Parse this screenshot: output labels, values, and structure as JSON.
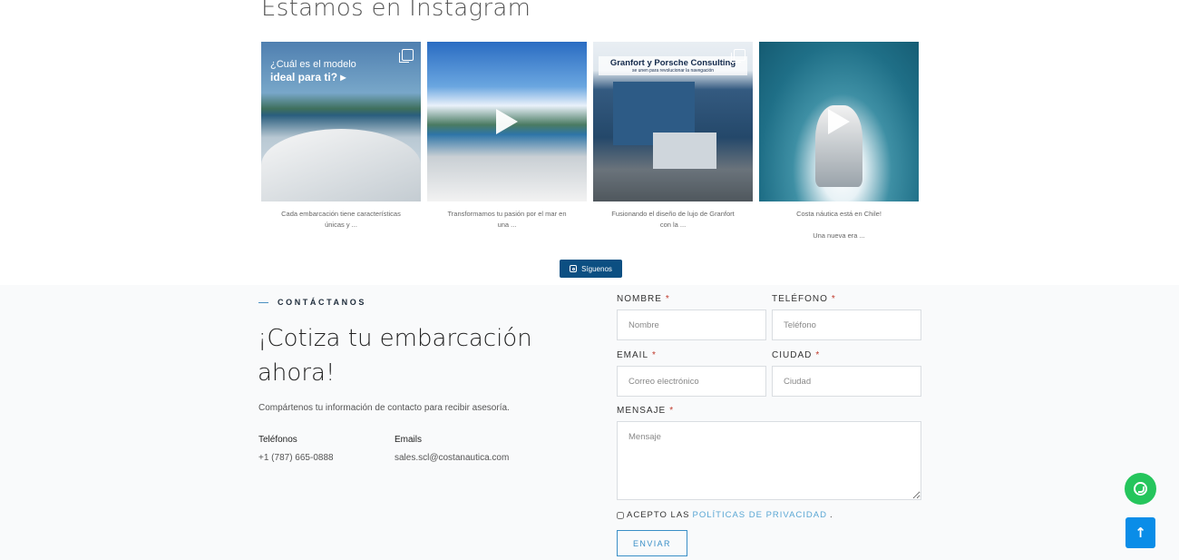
{
  "instagram": {
    "title": "Estamos en Instagram",
    "posts": [
      {
        "overlay_line1": "¿Cuál es el modelo",
        "overlay_line2": "ideal para ti? ▸",
        "caption_1": "Cada embarcación tiene características",
        "caption_2": "únicas y ...",
        "caption_3": ""
      },
      {
        "caption_1": "Transformamos tu pasión por el mar en",
        "caption_2": "una ...",
        "caption_3": ""
      },
      {
        "overlay_head": "Granfort y Porsche Consulting",
        "overlay_sub": "se unen para revolucionar la navegación",
        "caption_1": "Fusionando el diseño de lujo de Granfort",
        "caption_2": "con la ...",
        "caption_3": ""
      },
      {
        "caption_1": "Costa náutica está en Chile!",
        "caption_2": "",
        "caption_3": "Una nueva era ..."
      }
    ],
    "follow_label": "Síguenos"
  },
  "contact": {
    "eyebrow": "CONTÁCTANOS",
    "title": "¡Cotiza tu embarcación ahora!",
    "subtitle": "Compártenos tu información de contacto para recibir asesoría.",
    "phones_label": "Teléfonos",
    "phones_value": "+1 (787) 665-0888",
    "emails_label": "Emails",
    "emails_value": "sales.scl@costanautica.com"
  },
  "form": {
    "name_label": "NOMBRE",
    "name_placeholder": "Nombre",
    "phone_label": "TELÉFONO",
    "phone_placeholder": "Teléfono",
    "email_label": "EMAIL",
    "email_placeholder": "Correo electrónico",
    "city_label": "CIUDAD",
    "city_placeholder": "Ciudad",
    "message_label": "MENSAJE",
    "message_placeholder": "Mensaje",
    "required_mark": "*",
    "accept_prefix": "ACEPTO LAS",
    "accept_link": "POLÍTICAS DE PRIVACIDAD",
    "accept_suffix": ".",
    "submit_label": "ENVIAR"
  },
  "floating": {
    "whatsapp_icon": "whatsapp-icon",
    "top_arrow": "↑"
  },
  "colors": {
    "brand_blue": "#0c4f82",
    "accent_blue": "#3a8fc7",
    "link_blue": "#5aa7d4",
    "whatsapp_green": "#25c55c",
    "scroll_top_blue": "#0a8de8"
  }
}
